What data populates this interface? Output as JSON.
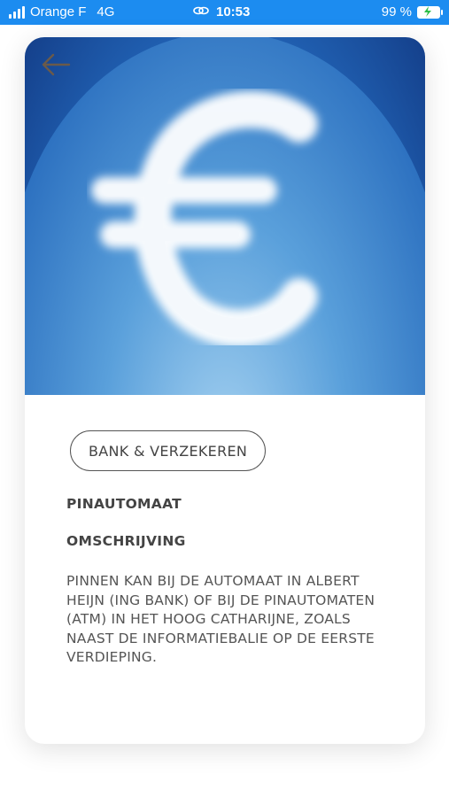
{
  "status_bar": {
    "carrier": "Orange F",
    "network": "4G",
    "time": "10:53",
    "battery": "99 %",
    "icons": [
      "signal-icon",
      "link-icon",
      "battery-charging-icon"
    ]
  },
  "hero": {
    "back_icon": "back-arrow-icon",
    "image": "cloud-euro-image"
  },
  "detail": {
    "category_tag": "BANK & VERZEKEREN",
    "title": "PINAUTOMAAT",
    "section_heading": "OMSCHRIJVING",
    "description": "PINNEN KAN BIJ DE AUTOMAAT IN ALBERT HEIJN (ING BANK) OF BIJ DE PINAUTOMATEN (ATM) IN HET HOOG CATHARIJNE, ZOALS NAAST DE INFORMATIEBALIE OP DE EERSTE VERDIEPING."
  },
  "colors": {
    "status_bar": "#1c8cf0",
    "text": "#444444",
    "sky_dark": "#143f8a",
    "sky_light": "#8fc4ec"
  }
}
